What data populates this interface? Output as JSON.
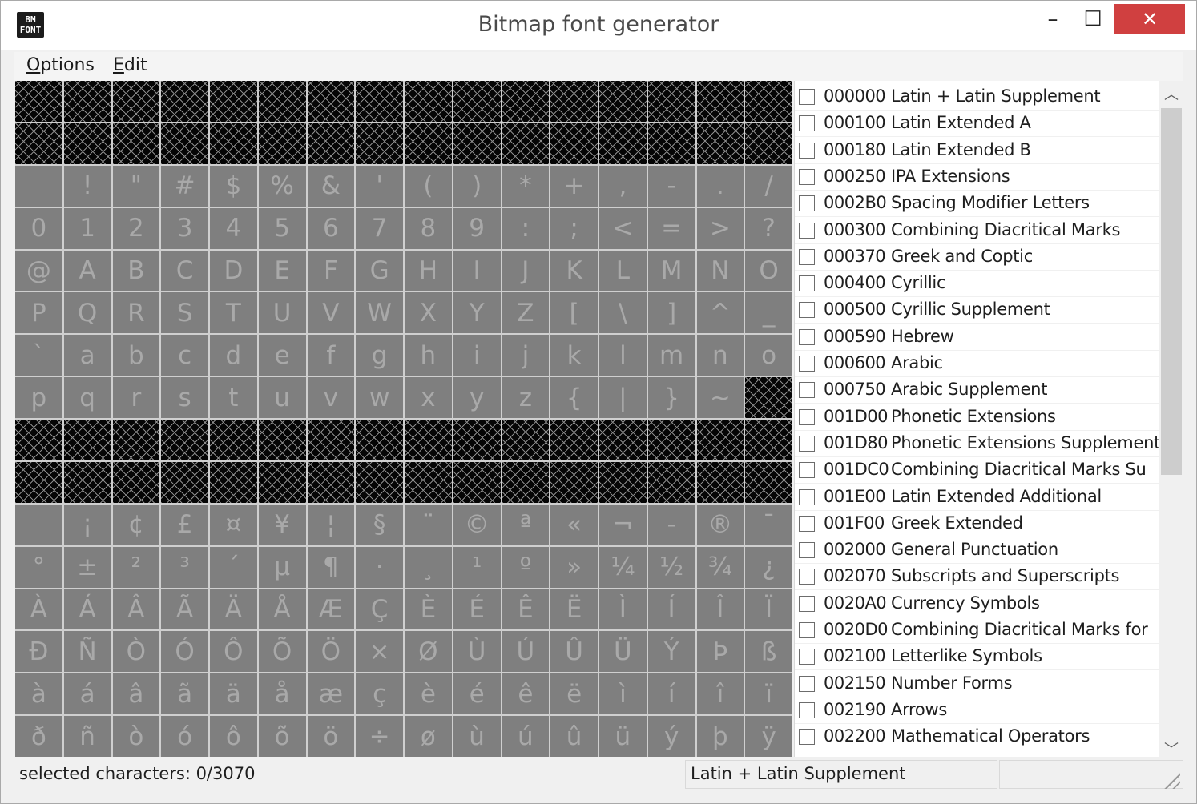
{
  "window": {
    "title": "Bitmap font generator",
    "icon_label": "BM FONT",
    "minimize_glyph": "–",
    "maximize_glyph": "☐",
    "close_glyph": "✕",
    "close_color": "#d04040"
  },
  "menu": {
    "options": {
      "underline": "O",
      "rest": "ptions"
    },
    "edit": {
      "underline": "E",
      "rest": "dit"
    }
  },
  "grid": {
    "rows": [
      [
        "",
        "",
        "",
        "",
        "",
        "",
        "",
        "",
        "",
        "",
        "",
        "",
        "",
        "",
        "",
        ""
      ],
      [
        "",
        "",
        "",
        "",
        "",
        "",
        "",
        "",
        "",
        "",
        "",
        "",
        "",
        "",
        "",
        ""
      ],
      [
        " ",
        "!",
        "\"",
        "#",
        "$",
        "%",
        "&",
        "'",
        "(",
        ")",
        "*",
        "+",
        ",",
        "-",
        ".",
        "/"
      ],
      [
        "0",
        "1",
        "2",
        "3",
        "4",
        "5",
        "6",
        "7",
        "8",
        "9",
        ":",
        ";",
        "<",
        "=",
        ">",
        "?"
      ],
      [
        "@",
        "A",
        "B",
        "C",
        "D",
        "E",
        "F",
        "G",
        "H",
        "I",
        "J",
        "K",
        "L",
        "M",
        "N",
        "O"
      ],
      [
        "P",
        "Q",
        "R",
        "S",
        "T",
        "U",
        "V",
        "W",
        "X",
        "Y",
        "Z",
        "[",
        "\\",
        "]",
        "^",
        "_"
      ],
      [
        "`",
        "a",
        "b",
        "c",
        "d",
        "e",
        "f",
        "g",
        "h",
        "i",
        "j",
        "k",
        "l",
        "m",
        "n",
        "o"
      ],
      [
        "p",
        "q",
        "r",
        "s",
        "t",
        "u",
        "v",
        "w",
        "x",
        "y",
        "z",
        "{",
        "|",
        "}",
        "~",
        ""
      ],
      [
        "",
        "",
        "",
        "",
        "",
        "",
        "",
        "",
        "",
        "",
        "",
        "",
        "",
        "",
        "",
        ""
      ],
      [
        "",
        "",
        "",
        "",
        "",
        "",
        "",
        "",
        "",
        "",
        "",
        "",
        "",
        "",
        "",
        ""
      ],
      [
        " ",
        "¡",
        "¢",
        "£",
        "¤",
        "¥",
        "¦",
        "§",
        "¨",
        "©",
        "ª",
        "«",
        "¬",
        "-",
        "®",
        "¯"
      ],
      [
        "°",
        "±",
        "²",
        "³",
        "´",
        "µ",
        "¶",
        "·",
        "¸",
        "¹",
        "º",
        "»",
        "¼",
        "½",
        "¾",
        "¿"
      ],
      [
        "À",
        "Á",
        "Â",
        "Ã",
        "Ä",
        "Å",
        "Æ",
        "Ç",
        "È",
        "É",
        "Ê",
        "Ë",
        "Ì",
        "Í",
        "Î",
        "Ï"
      ],
      [
        "Ð",
        "Ñ",
        "Ò",
        "Ó",
        "Ô",
        "Õ",
        "Ö",
        "×",
        "Ø",
        "Ù",
        "Ú",
        "Û",
        "Ü",
        "Ý",
        "Þ",
        "ß"
      ],
      [
        "à",
        "á",
        "â",
        "ã",
        "ä",
        "å",
        "æ",
        "ç",
        "è",
        "é",
        "ê",
        "ë",
        "ì",
        "í",
        "î",
        "ï"
      ],
      [
        "ð",
        "ñ",
        "ò",
        "ó",
        "ô",
        "õ",
        "ö",
        "÷",
        "ø",
        "ù",
        "ú",
        "û",
        "ü",
        "ý",
        "þ",
        "ÿ"
      ]
    ],
    "empty_cells": [
      [
        0,
        0
      ],
      [
        0,
        1
      ],
      [
        0,
        2
      ],
      [
        0,
        3
      ],
      [
        0,
        4
      ],
      [
        0,
        5
      ],
      [
        0,
        6
      ],
      [
        0,
        7
      ],
      [
        0,
        8
      ],
      [
        0,
        9
      ],
      [
        0,
        10
      ],
      [
        0,
        11
      ],
      [
        0,
        12
      ],
      [
        0,
        13
      ],
      [
        0,
        14
      ],
      [
        0,
        15
      ],
      [
        1,
        0
      ],
      [
        1,
        1
      ],
      [
        1,
        2
      ],
      [
        1,
        3
      ],
      [
        1,
        4
      ],
      [
        1,
        5
      ],
      [
        1,
        6
      ],
      [
        1,
        7
      ],
      [
        1,
        8
      ],
      [
        1,
        9
      ],
      [
        1,
        10
      ],
      [
        1,
        11
      ],
      [
        1,
        12
      ],
      [
        1,
        13
      ],
      [
        1,
        14
      ],
      [
        1,
        15
      ],
      [
        7,
        15
      ],
      [
        8,
        0
      ],
      [
        8,
        1
      ],
      [
        8,
        2
      ],
      [
        8,
        3
      ],
      [
        8,
        4
      ],
      [
        8,
        5
      ],
      [
        8,
        6
      ],
      [
        8,
        7
      ],
      [
        8,
        8
      ],
      [
        8,
        9
      ],
      [
        8,
        10
      ],
      [
        8,
        11
      ],
      [
        8,
        12
      ],
      [
        8,
        13
      ],
      [
        8,
        14
      ],
      [
        8,
        15
      ],
      [
        9,
        0
      ],
      [
        9,
        1
      ],
      [
        9,
        2
      ],
      [
        9,
        3
      ],
      [
        9,
        4
      ],
      [
        9,
        5
      ],
      [
        9,
        6
      ],
      [
        9,
        7
      ],
      [
        9,
        8
      ],
      [
        9,
        9
      ],
      [
        9,
        10
      ],
      [
        9,
        11
      ],
      [
        9,
        12
      ],
      [
        9,
        13
      ],
      [
        9,
        14
      ],
      [
        9,
        15
      ]
    ],
    "cell_color": "#7f7f7f",
    "glyph_color": "#a9a9a9",
    "empty_color": "#050505"
  },
  "ranges": [
    {
      "code": "000000",
      "name": "Latin + Latin Supplement",
      "checked": false
    },
    {
      "code": "000100",
      "name": "Latin Extended A",
      "checked": false
    },
    {
      "code": "000180",
      "name": "Latin Extended B",
      "checked": false
    },
    {
      "code": "000250",
      "name": "IPA Extensions",
      "checked": false
    },
    {
      "code": "0002B0",
      "name": "Spacing Modifier Letters",
      "checked": false
    },
    {
      "code": "000300",
      "name": "Combining Diacritical Marks",
      "checked": false
    },
    {
      "code": "000370",
      "name": "Greek and Coptic",
      "checked": false
    },
    {
      "code": "000400",
      "name": "Cyrillic",
      "checked": false
    },
    {
      "code": "000500",
      "name": "Cyrillic Supplement",
      "checked": false
    },
    {
      "code": "000590",
      "name": "Hebrew",
      "checked": false
    },
    {
      "code": "000600",
      "name": "Arabic",
      "checked": false
    },
    {
      "code": "000750",
      "name": "Arabic Supplement",
      "checked": false
    },
    {
      "code": "001D00",
      "name": "Phonetic Extensions",
      "checked": false
    },
    {
      "code": "001D80",
      "name": "Phonetic Extensions Supplement",
      "checked": false
    },
    {
      "code": "001DC0",
      "name": "Combining Diacritical Marks Su",
      "checked": false
    },
    {
      "code": "001E00",
      "name": "Latin Extended Additional",
      "checked": false
    },
    {
      "code": "001F00",
      "name": "Greek Extended",
      "checked": false
    },
    {
      "code": "002000",
      "name": "General Punctuation",
      "checked": false
    },
    {
      "code": "002070",
      "name": "Subscripts and Superscripts",
      "checked": false
    },
    {
      "code": "0020A0",
      "name": "Currency Symbols",
      "checked": false
    },
    {
      "code": "0020D0",
      "name": "Combining Diacritical Marks for",
      "checked": false
    },
    {
      "code": "002100",
      "name": "Letterlike Symbols",
      "checked": false
    },
    {
      "code": "002150",
      "name": "Number Forms",
      "checked": false
    },
    {
      "code": "002190",
      "name": "Arrows",
      "checked": false
    },
    {
      "code": "002200",
      "name": "Mathematical Operators",
      "checked": false
    }
  ],
  "scrollbar": {
    "up_glyph": "︿",
    "down_glyph": "﹀"
  },
  "status": {
    "selected": "selected characters: 0/3070",
    "current_range": "Latin + Latin Supplement",
    "extra": ""
  }
}
